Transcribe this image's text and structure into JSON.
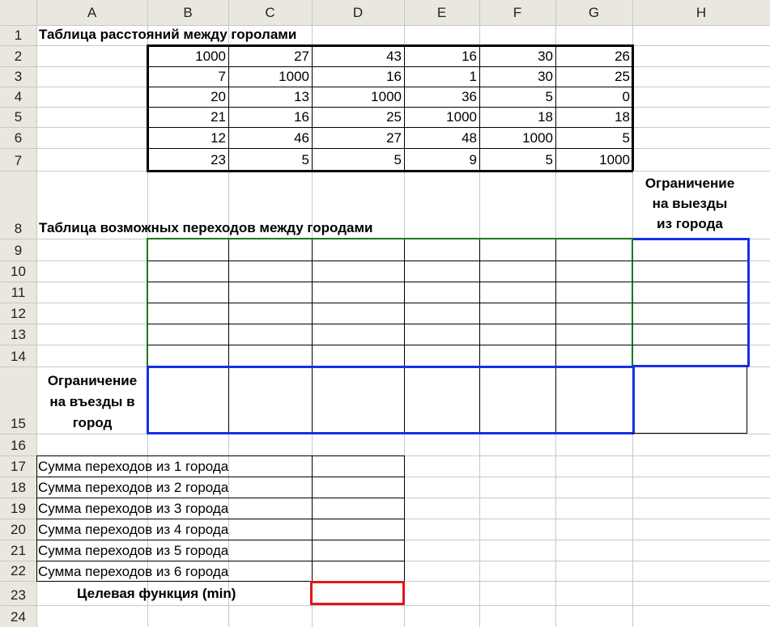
{
  "columns": [
    "A",
    "B",
    "C",
    "D",
    "E",
    "F",
    "G",
    "H"
  ],
  "rows": [
    "1",
    "2",
    "3",
    "4",
    "5",
    "6",
    "7",
    "8",
    "9",
    "10",
    "11",
    "12",
    "13",
    "14",
    "15",
    "16",
    "17",
    "18",
    "19",
    "20",
    "21",
    "22",
    "23",
    "24"
  ],
  "title1": "Таблица расстояний между горолами",
  "distances": [
    [
      "1000",
      "27",
      "43",
      "16",
      "30",
      "26"
    ],
    [
      "7",
      "1000",
      "16",
      "1",
      "30",
      "25"
    ],
    [
      "20",
      "13",
      "1000",
      "36",
      "5",
      "0"
    ],
    [
      "21",
      "16",
      "25",
      "1000",
      "18",
      "18"
    ],
    [
      "12",
      "46",
      "27",
      "48",
      "1000",
      "5"
    ],
    [
      "23",
      "5",
      "5",
      "9",
      "5",
      "1000"
    ]
  ],
  "title2": "Таблица возможных переходов между городами",
  "out_limit": [
    "Ограничение",
    "на выезды",
    "из города"
  ],
  "in_limit": [
    "Ограничение",
    "на въезды в",
    "город"
  ],
  "sums": [
    "Сумма переходов из 1 города",
    "Сумма переходов из 2 города",
    "Сумма переходов из 3 города",
    "Сумма переходов из 4 города",
    "Сумма переходов из 5 города",
    "Сумма переходов из 6 города"
  ],
  "objective": "Целевая функция (min)",
  "colors": {
    "grid": "#c8c8c8",
    "header_bg": "#e9e7de",
    "green_border": "#1b7a1b",
    "blue_border": "#1530e6",
    "red_border": "#e01818"
  }
}
